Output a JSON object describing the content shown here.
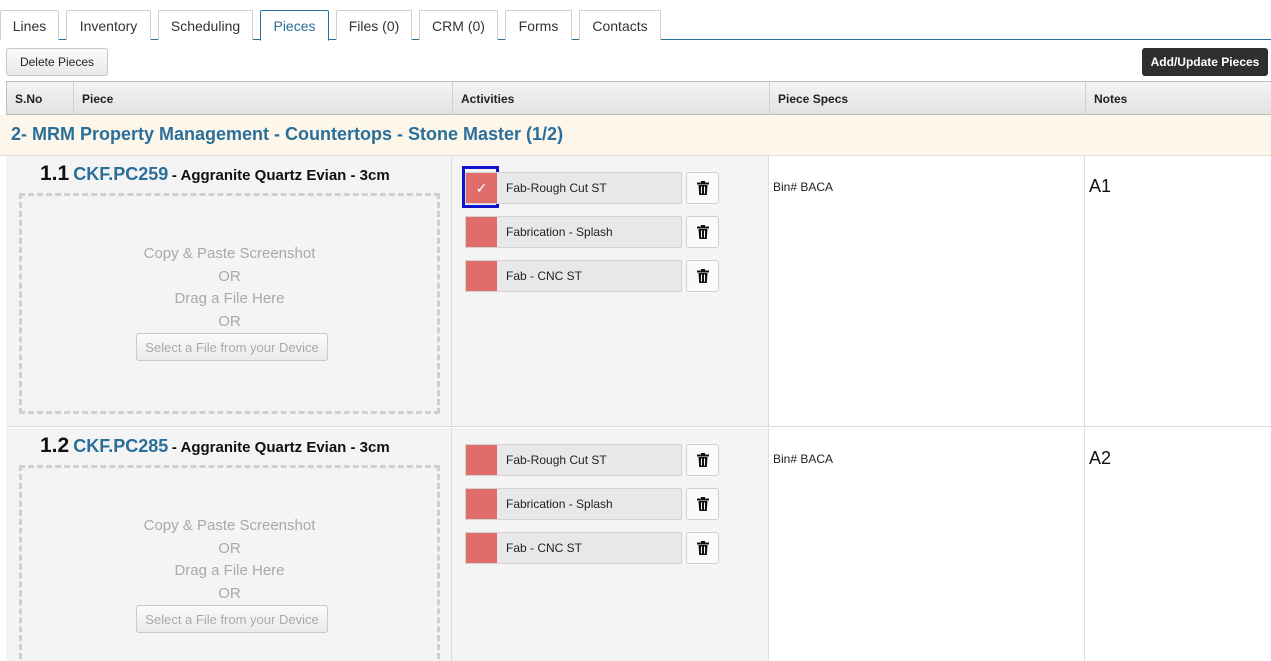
{
  "tabs": [
    {
      "label": "Lines"
    },
    {
      "label": "Inventory"
    },
    {
      "label": "Scheduling"
    },
    {
      "label": "Pieces"
    },
    {
      "label": "Files (0)"
    },
    {
      "label": "CRM (0)"
    },
    {
      "label": "Forms"
    },
    {
      "label": "Contacts"
    }
  ],
  "active_tab": "Pieces",
  "toolbar": {
    "delete_label": "Delete Pieces",
    "add_update_label": "Add/Update Pieces"
  },
  "table": {
    "headers": [
      "S.No",
      "Piece",
      "Activities",
      "Piece Specs",
      "Notes"
    ]
  },
  "group": {
    "title": "2- MRM Property Management - Countertops - Stone Master (1/2)"
  },
  "dropzone": {
    "line1": "Copy & Paste Screenshot",
    "or1": "OR",
    "line2": "Drag a File Here",
    "or2": "OR",
    "button": "Select a File from your Device"
  },
  "pieces": [
    {
      "number": "1.1",
      "code": "CKF.PC259",
      "description": "- Aggranite Quartz Evian - 3cm",
      "activities": [
        {
          "label": "Fab-Rough Cut ST",
          "checked": true
        },
        {
          "label": "Fabrication - Splash",
          "checked": false
        },
        {
          "label": "Fab - CNC ST",
          "checked": false
        }
      ],
      "specs": "Bin# BACA",
      "notes": "A1"
    },
    {
      "number": "1.2",
      "code": "CKF.PC285",
      "description": "- Aggranite Quartz Evian - 3cm",
      "activities": [
        {
          "label": "Fab-Rough Cut ST",
          "checked": false
        },
        {
          "label": "Fabrication - Splash",
          "checked": false
        },
        {
          "label": "Fab - CNC ST",
          "checked": false
        }
      ],
      "specs": "Bin# BACA",
      "notes": "A2"
    }
  ],
  "colors": {
    "accent": "#2a6f9a",
    "activity_swatch": "#e06c6c",
    "group_background": "#fdf6ea",
    "focus_ring": "#1313c9"
  },
  "icons": {
    "delete": "trash-icon",
    "checked": "check-icon"
  }
}
